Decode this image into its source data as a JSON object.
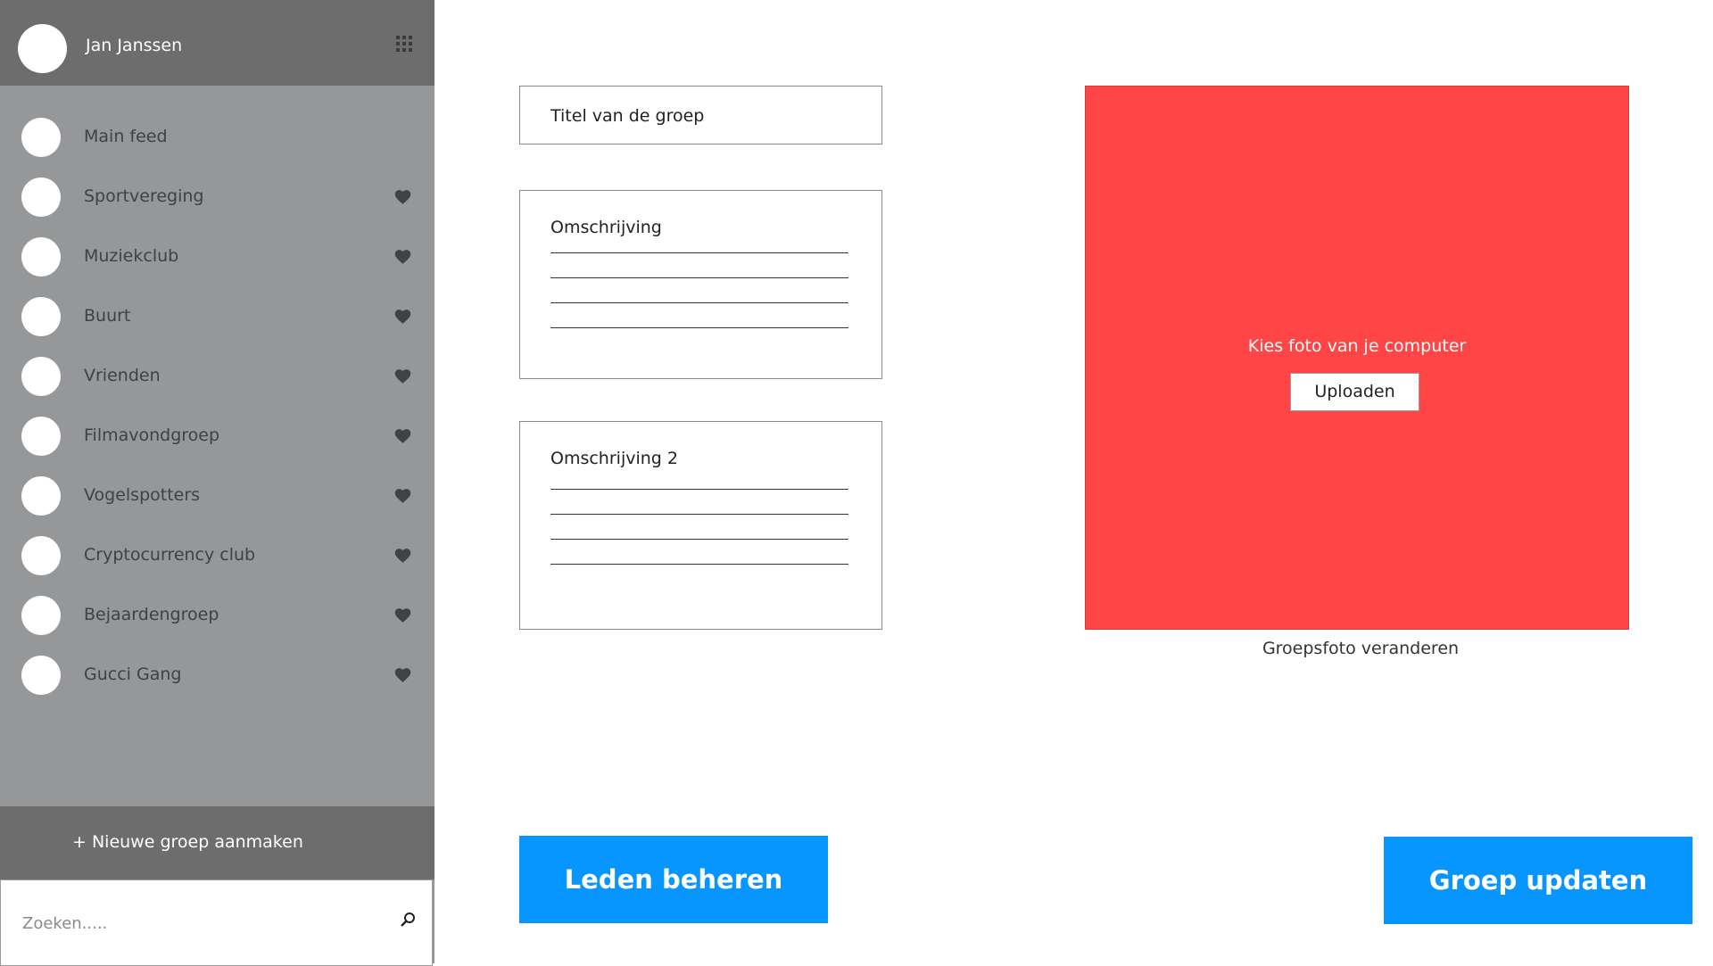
{
  "user": {
    "name": "Jan Janssen"
  },
  "sidebar": {
    "items": [
      {
        "label": "Main feed",
        "favorite": false
      },
      {
        "label": "Sportvereging",
        "favorite": true
      },
      {
        "label": "Muziekclub",
        "favorite": true
      },
      {
        "label": "Buurt",
        "favorite": true
      },
      {
        "label": "Vrienden",
        "favorite": true
      },
      {
        "label": "Filmavondgroep",
        "favorite": true
      },
      {
        "label": "Vogelspotters",
        "favorite": true
      },
      {
        "label": "Cryptocurrency club",
        "favorite": true
      },
      {
        "label": "Bejaardengroep",
        "favorite": true
      },
      {
        "label": "Gucci Gang",
        "favorite": true
      }
    ],
    "new_group_label": "+ Nieuwe groep aanmaken",
    "search_placeholder": "Zoeken....."
  },
  "form": {
    "title_placeholder": "Titel van de groep",
    "description_label": "Omschrijving",
    "description2_label": "Omschrijving 2"
  },
  "photo": {
    "prompt": "Kies foto van je computer",
    "upload_label": "Uploaden",
    "caption": "Groepsfoto veranderen",
    "background_color": "#ff4545"
  },
  "actions": {
    "members_label": "Leden beheren",
    "update_label": "Groep updaten",
    "button_color": "#0796ff"
  },
  "icons": {
    "apps": "grid-apps-icon",
    "favorite": "heart-icon",
    "search": "search-icon"
  }
}
